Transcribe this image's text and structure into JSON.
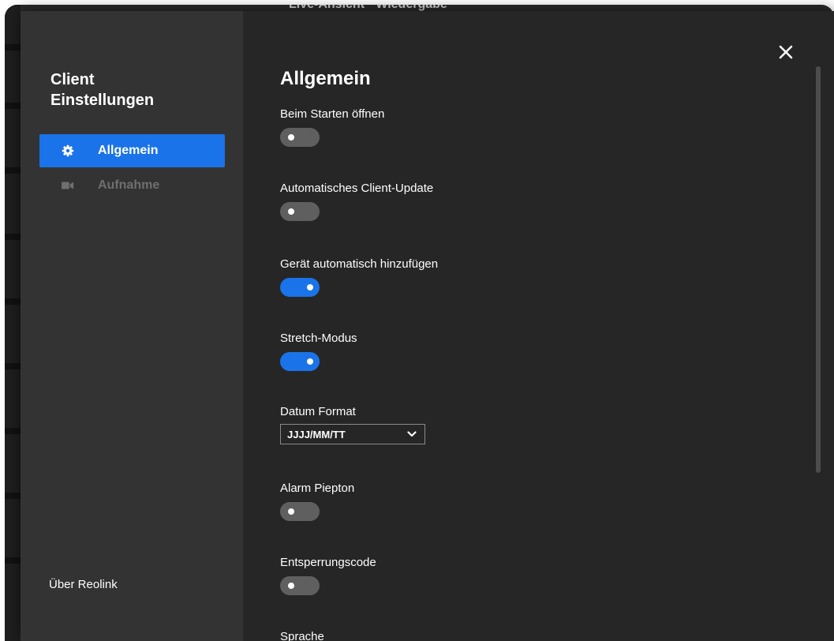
{
  "background": {
    "text": "Live-Ansicht  ·  Wiedergabe"
  },
  "sidebar": {
    "title_line1": "Client",
    "title_line2": "Einstellungen",
    "items": [
      {
        "label": "Allgemein",
        "icon": "gear-icon",
        "active": true
      },
      {
        "label": "Aufnahme",
        "icon": "video-camera-icon",
        "active": false
      }
    ],
    "about_label": "Über Reolink"
  },
  "content": {
    "title": "Allgemein",
    "settings": {
      "open_on_start": {
        "label": "Beim Starten öffnen",
        "enabled": false
      },
      "auto_update": {
        "label": "Automatisches Client-Update",
        "enabled": false
      },
      "auto_add_device": {
        "label": "Gerät automatisch hinzufügen",
        "enabled": true
      },
      "stretch_mode": {
        "label": "Stretch-Modus",
        "enabled": true
      },
      "date_format": {
        "label": "Datum Format",
        "value": "JJJJ/MM/TT"
      },
      "alarm_beep": {
        "label": "Alarm Piepton",
        "enabled": false
      },
      "unlock_code": {
        "label": "Entsperrungscode",
        "enabled": false
      },
      "language": {
        "label": "Sprache"
      }
    }
  },
  "colors": {
    "accent": "#1a73e8",
    "sidebar_bg": "#333333",
    "content_bg": "#262626",
    "toggle_off": "#5f5f5f"
  }
}
